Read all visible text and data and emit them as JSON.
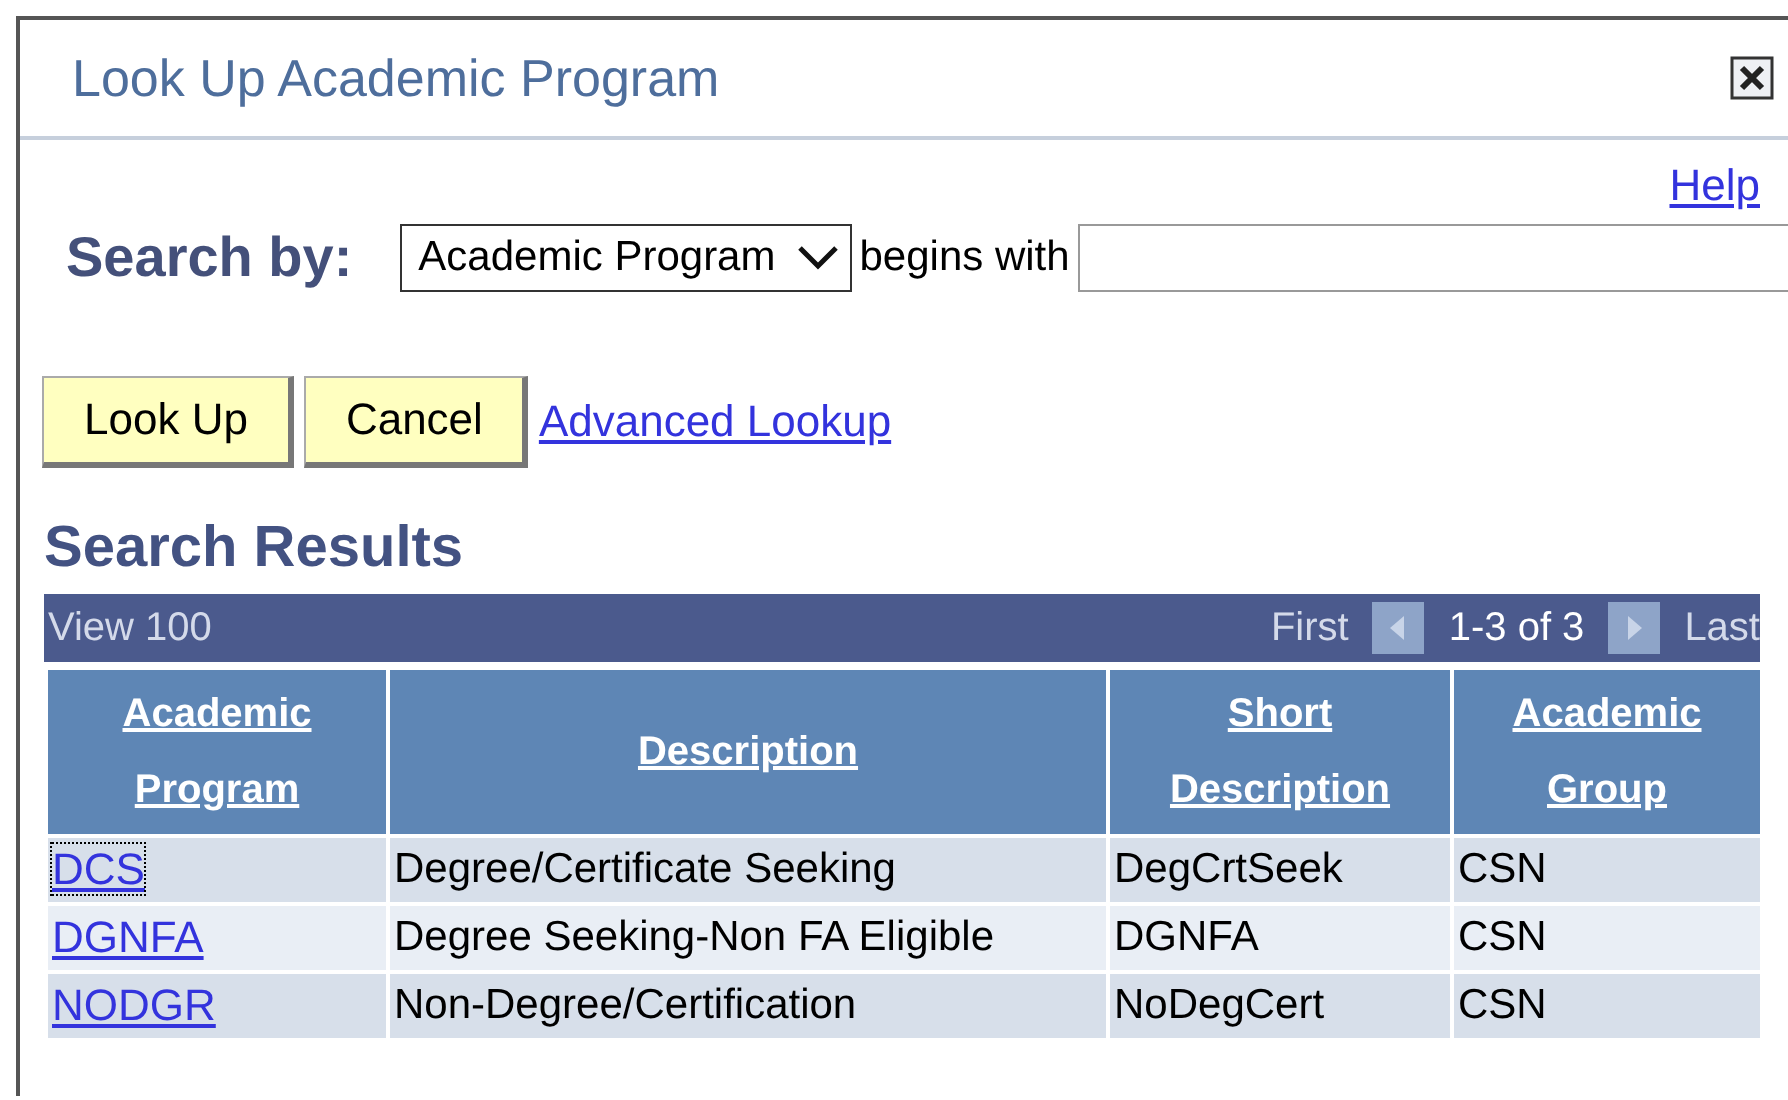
{
  "window": {
    "title": "Look Up Academic Program"
  },
  "help_link": "Help",
  "search": {
    "label": "Search by:",
    "field": "Academic Program",
    "operator": "begins with"
  },
  "buttons": [
    "Look Up",
    "Cancel"
  ],
  "advanced_link": "Advanced Lookup",
  "results": {
    "title": "Search Results",
    "view": "View 100",
    "first": "First",
    "range": "1-3 of 3",
    "last": "Last",
    "columns": [
      [
        "Academic",
        "Program"
      ],
      [
        "Description"
      ],
      [
        "Short",
        "Description"
      ],
      [
        "Academic",
        "Group"
      ]
    ],
    "rows": [
      {
        "program": "DCS",
        "focused": true,
        "description": "Degree/Certificate Seeking",
        "short": "DegCrtSeek",
        "group": "CSN"
      },
      {
        "program": "DGNFA",
        "focused": false,
        "description": "Degree Seeking-Non FA Eligible",
        "short": "DGNFA",
        "group": "CSN"
      },
      {
        "program": "NODGR",
        "focused": false,
        "description": "Non-Degree/Certification",
        "short": "NoDegCert",
        "group": "CSN"
      }
    ]
  }
}
